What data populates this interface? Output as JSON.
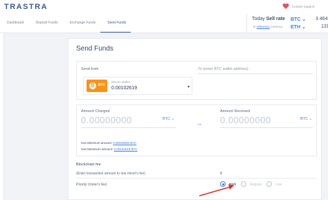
{
  "brand": {
    "name": "TRASTRA"
  },
  "header": {
    "support_label": "Contact Support",
    "nav": [
      {
        "label": "Dashboard"
      },
      {
        "label": "Deposit Funds"
      },
      {
        "label": "Exchange Funds"
      },
      {
        "label": "Send Funds"
      }
    ],
    "rate": {
      "prefix": "Today",
      "title": "Sell rate",
      "currency_text": "in",
      "currency_link": "reference",
      "currency_suffix": "currency",
      "coins": [
        {
          "symbol": "BTC",
          "value": "3 464"
        },
        {
          "symbol": "ETH",
          "value": "131"
        }
      ]
    }
  },
  "send": {
    "title": "Send Funds",
    "send_from_label": "Send from",
    "wallet": {
      "badge": "BTC",
      "name": "Bitcoin Wallet",
      "balance": "0.00102619"
    },
    "to_placeholder": "To (enter BTC wallet address)",
    "charged_label": "Amount Charged",
    "charged_value": "0.00000000",
    "charged_unit": "BTC",
    "received_label": "Amount Received",
    "received_value": "0.00000000",
    "received_unit": "BTC",
    "min_label": "Use Minimum amount:",
    "min_value": "0.00020000 BTC",
    "max_label": "Use Maximum amount:",
    "max_value": "0.00102619 BTC",
    "fee_title": "Blockchain fee",
    "fee_hint": "(Enter transaction amount to see miner's fee)",
    "fee_value": "0",
    "priority_label": "Priority (miner's fee)",
    "priority_options": [
      {
        "label": "High",
        "selected": true
      },
      {
        "label": "Regular",
        "selected": false
      },
      {
        "label": "Low",
        "selected": false
      }
    ]
  },
  "colors": {
    "accent": "#3b7dd8",
    "bitcoin": "#f7931a",
    "heart": "#e8505b",
    "annotation_arrow": "#e02a2a"
  }
}
